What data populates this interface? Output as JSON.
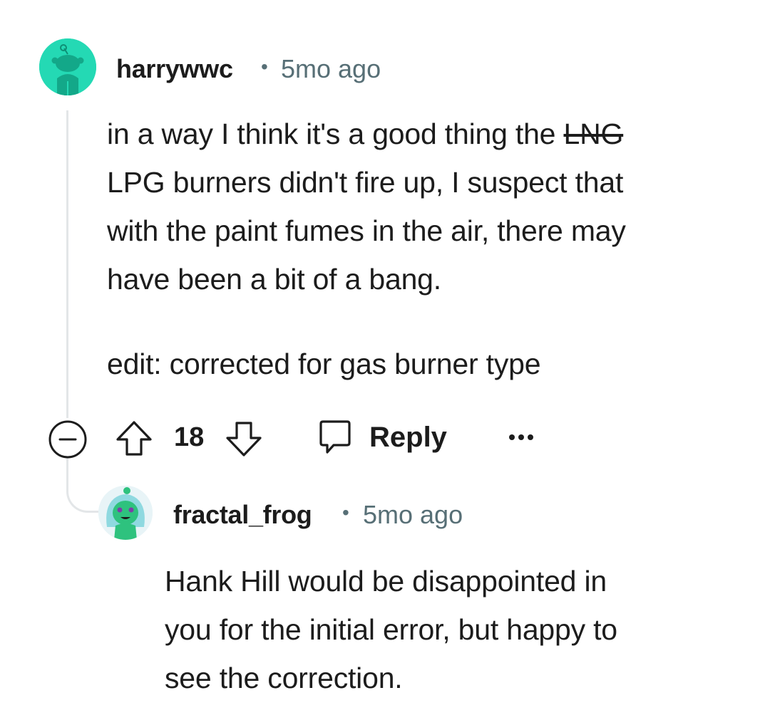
{
  "parent_comment": {
    "author": "harrywwc",
    "separator": "•",
    "age": "5mo ago",
    "body_lines": [
      {
        "before": "in a way I think it's a good thing the ",
        "struck": "LNG"
      },
      {
        "text": "LPG burners didn't fire up, I suspect that"
      },
      {
        "text": "with the paint fumes in the air, there may"
      },
      {
        "text": "have been a bit of a bang."
      }
    ],
    "edit_note": "edit: corrected for gas burner type",
    "vote_count": "18",
    "reply_label": "Reply",
    "more_label": "•••",
    "avatar_color": "#24d9b4",
    "icons": [
      "collapse-icon",
      "upvote-icon",
      "downvote-icon",
      "reply-icon",
      "more-options-icon"
    ]
  },
  "child_comment": {
    "author": "fractal_frog",
    "separator": "•",
    "age": "5mo ago",
    "body_lines": [
      "Hank Hill would be disappointed in",
      "you for the initial error, but happy to",
      "see the correction."
    ],
    "avatar_color": "#2ec27e"
  },
  "colors": {
    "text": "#1c1c1c",
    "meta": "#576f76",
    "thread_line": "#e3e6e8"
  }
}
